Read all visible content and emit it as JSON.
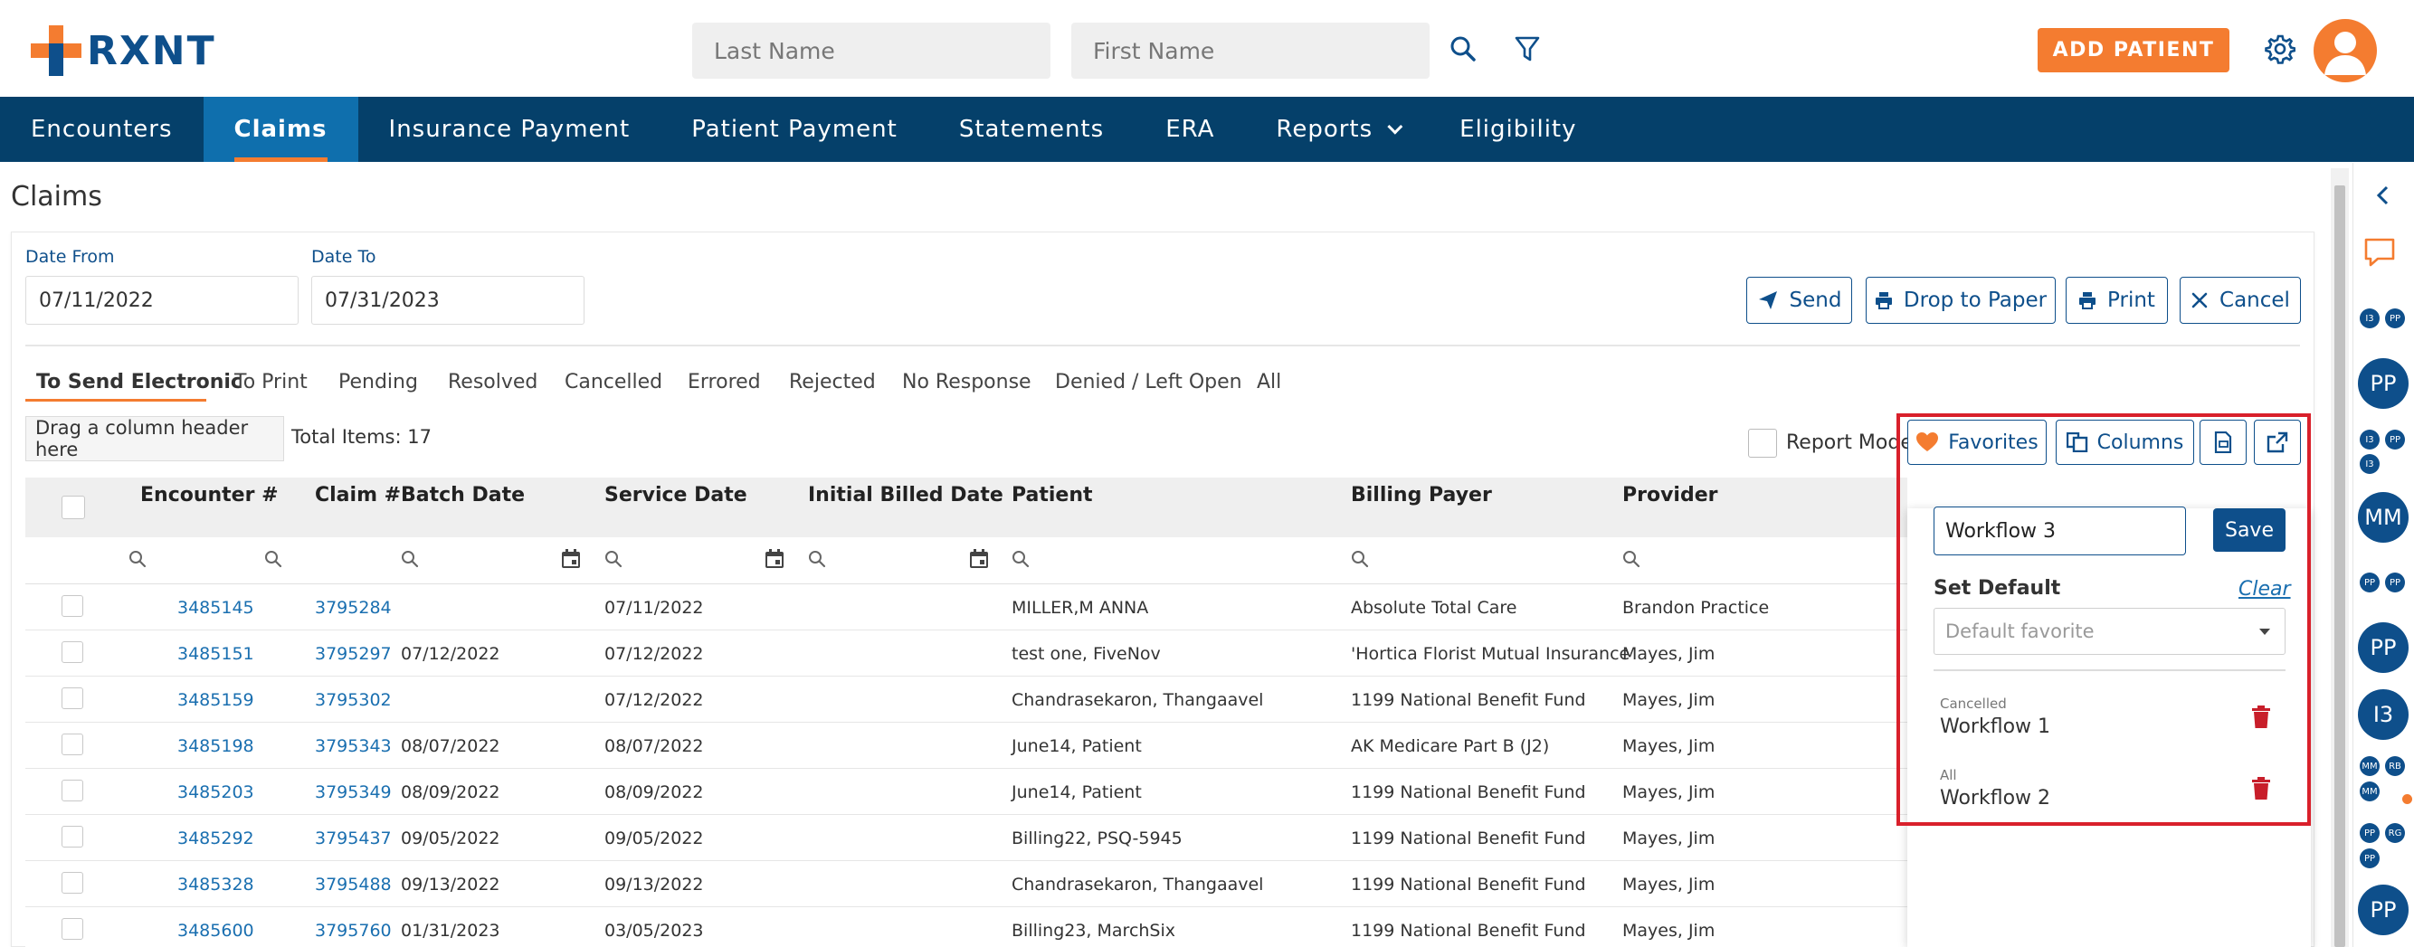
{
  "header": {
    "logo_text": "RXNT",
    "last_name_placeholder": "Last Name",
    "first_name_placeholder": "First Name",
    "add_patient_label": "ADD PATIENT"
  },
  "nav": {
    "items": [
      "Encounters",
      "Claims",
      "Insurance Payment",
      "Patient Payment",
      "Statements",
      "ERA",
      "Reports",
      "Eligibility"
    ],
    "active": "Claims"
  },
  "page": {
    "title": "Claims",
    "date_from_label": "Date From",
    "date_from": "07/11/2022",
    "date_to_label": "Date To",
    "date_to": "07/31/2023",
    "actions": {
      "send": "Send",
      "drop_to_paper": "Drop to Paper",
      "print": "Print",
      "cancel": "Cancel"
    }
  },
  "tabs": [
    "To Send Electronic",
    "To Print",
    "Pending",
    "Resolved",
    "Cancelled",
    "Errored",
    "Rejected",
    "No Response",
    "Denied / Left Open",
    "All"
  ],
  "toolbar": {
    "drag_hint": "Drag a column header here",
    "total_items": "Total Items: 17",
    "report_mode": "Report Mode",
    "favorites_label": "Favorites",
    "columns_label": "Columns"
  },
  "grid": {
    "columns": [
      "Encounter #",
      "Claim #",
      "Batch Date",
      "Service Date",
      "Initial Billed Date",
      "Patient",
      "Billing Payer",
      "Provider"
    ],
    "rows": [
      [
        "3485145",
        "3795284",
        "",
        "07/11/2022",
        "",
        "MILLER,M ANNA",
        "Absolute Total Care",
        "Brandon Practice"
      ],
      [
        "3485151",
        "3795297",
        "07/12/2022",
        "07/12/2022",
        "",
        "test one, FiveNov",
        "'Hortica Florist Mutual Insurance",
        "Mayes, Jim"
      ],
      [
        "3485159",
        "3795302",
        "",
        "07/12/2022",
        "",
        "Chandrasekaron, Thangaavel",
        "1199 National Benefit Fund",
        "Mayes, Jim"
      ],
      [
        "3485198",
        "3795343",
        "08/07/2022",
        "08/07/2022",
        "",
        "June14, Patient",
        "AK Medicare Part B (J2)",
        "Mayes, Jim"
      ],
      [
        "3485203",
        "3795349",
        "08/09/2022",
        "08/09/2022",
        "",
        "June14, Patient",
        "1199 National Benefit Fund",
        "Mayes, Jim"
      ],
      [
        "3485292",
        "3795437",
        "09/05/2022",
        "09/05/2022",
        "",
        "Billing22, PSQ-5945",
        "1199 National Benefit Fund",
        "Mayes, Jim"
      ],
      [
        "3485328",
        "3795488",
        "09/13/2022",
        "09/13/2022",
        "",
        "Chandrasekaron, Thangaavel",
        "1199 National Benefit Fund",
        "Mayes, Jim"
      ],
      [
        "3485600",
        "3795760",
        "01/31/2023",
        "03/05/2023",
        "",
        "Billing23, MarchSix",
        "1199 National Benefit Fund",
        "Mayes, Jim"
      ]
    ]
  },
  "favorites": {
    "name_value": "Workflow 3",
    "save_label": "Save",
    "set_default_label": "Set Default",
    "clear_label": "Clear",
    "default_placeholder": "Default favorite",
    "items": [
      {
        "category": "Cancelled",
        "name": "Workflow 1"
      },
      {
        "category": "All",
        "name": "Workflow 2"
      }
    ]
  },
  "rail": {
    "avatars": [
      "I3",
      "PP",
      "PP",
      "I3",
      "PP",
      "I3",
      "MM",
      "PP",
      "PP",
      "PP",
      "I3",
      "MM",
      "RB",
      "MM",
      "PP",
      "RG",
      "PP"
    ]
  },
  "colors": {
    "brand_orange": "#f47c30",
    "brand_blue": "#0e4f8b",
    "nav_bg": "#05406a",
    "nav_active": "#0f6fad",
    "highlight_red": "#d9202b"
  }
}
